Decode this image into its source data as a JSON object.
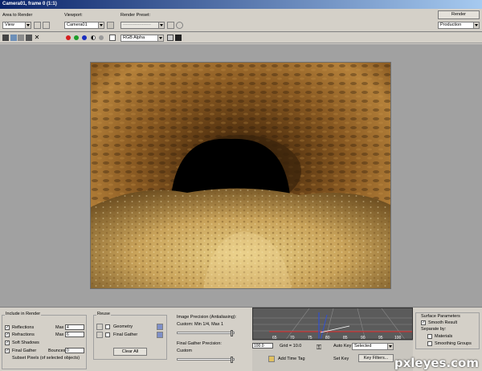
{
  "window": {
    "title": "Camera01, frame 0 (1:1)"
  },
  "top": {
    "area_label": "Area to Render",
    "area_value": "View",
    "viewport_label": "Viewport:",
    "viewport_value": "Camera01",
    "preset_label": "Render Preset:",
    "preset_value": "-------------------",
    "render_button": "Render",
    "quality_value": "Production"
  },
  "toolbar": {
    "channel_value": "RGB Alpha",
    "channel_colors": {
      "red": "#d62020",
      "green": "#1e9e2a",
      "blue": "#1b2fbf"
    }
  },
  "render": {
    "scene": "cave-tunnel-render"
  },
  "include": {
    "title": "Include in Render",
    "reflections": "Reflections",
    "refl_max_label": "Max",
    "refl_max": "4",
    "refractions": "Refractions",
    "refr_max_label": "Max",
    "refr_max": "6",
    "soft_shadows": "Soft Shadows",
    "final_gather": "Final Gather",
    "bounces_label": "Bounces",
    "bounces": "0",
    "subset_pixels": "Subset Pixels (of selected objects)"
  },
  "reuse": {
    "title": "Reuse",
    "geometry": "Geometry",
    "final_gather": "Final Gather",
    "clear_all": "Clear All"
  },
  "precision": {
    "title": "Image Precision (Antialiasing):",
    "value": "Custom: Min 1/4, Max 1",
    "fg_title": "Final Gather Precision:",
    "fg_value": "Custom"
  },
  "viewport3d": {
    "ticks": [
      "65",
      "70",
      "75",
      "80",
      "85",
      "90",
      "95",
      "100"
    ]
  },
  "timeline": {
    "frame_value": "100.0",
    "grid_label": "Grid = 10.0",
    "add_time_tag": "Add Time Tag",
    "auto_key": "Auto Key",
    "set_key": "Set Key",
    "selected_value": "Selected",
    "key_filters": "Key Filters..."
  },
  "surface": {
    "title": "Surface Parameters",
    "smooth_result": "Smooth Result",
    "separate_by": "Separate by:",
    "materials": "Materials",
    "smoothing_groups": "Smoothing Groups"
  },
  "watermark": "pxleyes.com"
}
